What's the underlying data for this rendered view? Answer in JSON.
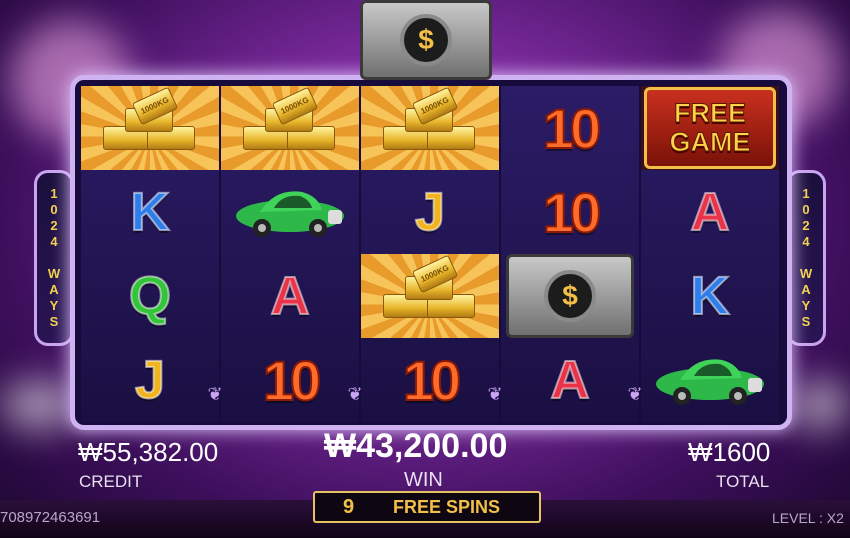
{
  "side_label": "1024 WAYS",
  "balance": {
    "credit_value": "₩55,382.00",
    "credit_label": "CREDIT",
    "win_value": "₩43,200.00",
    "win_label": "WIN",
    "total_value": "₩1600",
    "total_label": "TOTAL"
  },
  "free_spins": {
    "count": "9",
    "label": "FREE SPINS"
  },
  "footer": {
    "id_text": "708972463691",
    "level_text": "LEVEL : X2"
  },
  "symbols": {
    "free_game_line1": "FREE",
    "free_game_line2": "GAME",
    "dollar": "$",
    "gold_stamp": "1000KG"
  },
  "reels": [
    [
      "gold",
      "K",
      "Q",
      "J"
    ],
    [
      "gold",
      "car",
      "A",
      "10"
    ],
    [
      "gold",
      "J",
      "gold",
      "10"
    ],
    [
      "10",
      "10",
      "safe",
      "A"
    ],
    [
      "free-game",
      "A",
      "K",
      "car"
    ]
  ],
  "colors": {
    "K": "#2f7de8",
    "Q": "#33c43a",
    "J": "#f2b41e",
    "A": "#e8344a",
    "ten": "#ff6b2a",
    "gold": "#f2b93a",
    "car": "#2fb84a"
  }
}
